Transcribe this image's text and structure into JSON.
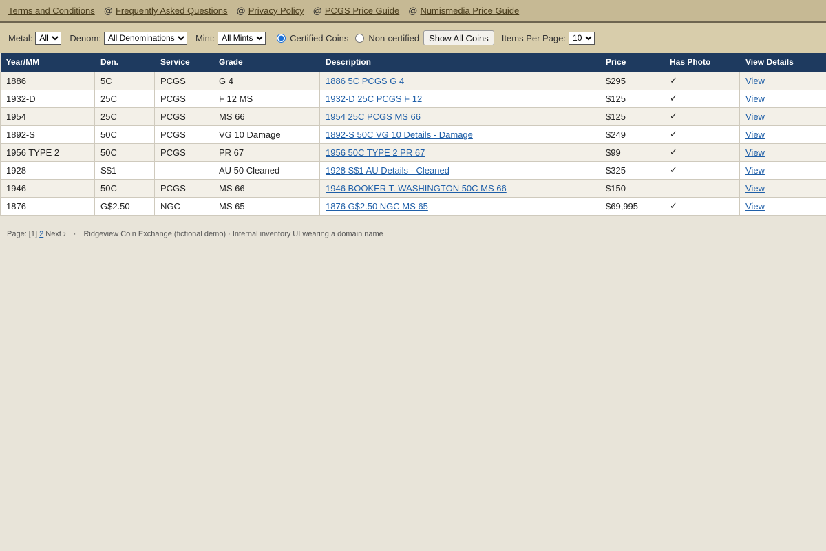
{
  "topnav": {
    "links": [
      "Terms and Conditions",
      "Frequently Asked Questions",
      "Privacy Policy",
      "PCGS Price Guide",
      "Numismedia Price Guide"
    ],
    "separator": "@"
  },
  "filters": {
    "metal_label": "Metal:",
    "metal_value": "All",
    "denom_label": "Denom:",
    "denom_value": "All Denominations",
    "mint_label": "Mint:",
    "mint_value": "All Mints",
    "certified_label": "Certified Coins",
    "noncertified_label": "Non-certified",
    "show_all_label": "Show All Coins",
    "items_label": "Items Per Page:",
    "items_value": "10"
  },
  "table": {
    "headers": [
      "Year/MM",
      "Den.",
      "Service",
      "Grade",
      "Description",
      "Price",
      "Has Photo",
      "View Details"
    ],
    "rows": [
      {
        "year": "1886",
        "den": "5C",
        "service": "PCGS",
        "grade": "G 4",
        "desc": "1886 5C PCGS G 4",
        "price": "$295",
        "photo": "✓",
        "view": "View"
      },
      {
        "year": "1932-D",
        "den": "25C",
        "service": "PCGS",
        "grade": "F 12 MS",
        "desc": "1932-D 25C PCGS F 12",
        "price": "$125",
        "photo": "✓",
        "view": "View"
      },
      {
        "year": "1954",
        "den": "25C",
        "service": "PCGS",
        "grade": "MS 66",
        "desc": "1954 25C PCGS MS 66",
        "price": "$125",
        "photo": "✓",
        "view": "View"
      },
      {
        "year": "1892-S",
        "den": "50C",
        "service": "PCGS",
        "grade": "VG 10 Damage",
        "desc": "1892-S 50C VG 10 Details - Damage",
        "price": "$249",
        "photo": "✓",
        "view": "View"
      },
      {
        "year": "1956 TYPE 2",
        "den": "50C",
        "service": "PCGS",
        "grade": "PR 67",
        "desc": "1956 50C TYPE 2 PR 67",
        "price": "$99",
        "photo": "✓",
        "view": "View"
      },
      {
        "year": "1928",
        "den": "S$1",
        "service": "",
        "grade": "AU 50 Cleaned",
        "desc": "1928 S$1 AU Details - Cleaned",
        "price": "$325",
        "photo": "✓",
        "view": "View"
      },
      {
        "year": "1946",
        "den": "50C",
        "service": "PCGS",
        "grade": "MS 66",
        "desc": "1946 BOOKER T. WASHINGTON 50C MS 66",
        "price": "$150",
        "photo": "",
        "view": "View"
      },
      {
        "year": "1876",
        "den": "G$2.50",
        "service": "NGC",
        "grade": "MS 65",
        "desc": "1876 G$2.50 NGC MS 65",
        "price": "$69,995",
        "photo": "✓",
        "view": "View"
      }
    ]
  },
  "footer": {
    "page_prefix": "Page: [1]",
    "page_2": "2",
    "next_label": "Next ›",
    "dot": "·",
    "note": "Ridgeview Coin Exchange (fictional demo) · Internal inventory UI wearing a domain name"
  }
}
